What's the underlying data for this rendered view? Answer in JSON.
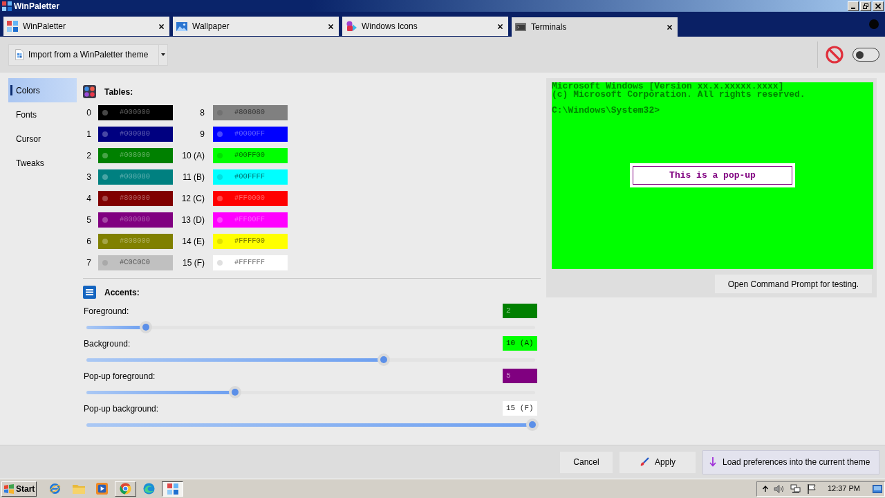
{
  "window": {
    "title": "WinPaletter"
  },
  "tabs": [
    {
      "label": "WinPaletter",
      "selected": false
    },
    {
      "label": "Wallpaper",
      "selected": false
    },
    {
      "label": "Windows Icons",
      "selected": false
    },
    {
      "label": "Terminals",
      "selected": true
    }
  ],
  "toolbar": {
    "import_button": "Import from a WinPaletter theme",
    "toggle": {
      "on": false
    }
  },
  "sidebar": {
    "items": [
      {
        "label": "Colors",
        "selected": true
      },
      {
        "label": "Fonts",
        "selected": false
      },
      {
        "label": "Cursor",
        "selected": false
      },
      {
        "label": "Tweaks",
        "selected": false
      }
    ]
  },
  "tables": {
    "title": "Tables:",
    "swatches": [
      {
        "index": "0",
        "hex": "#000000",
        "color": "#000000"
      },
      {
        "index": "1",
        "hex": "#000080",
        "color": "#000080"
      },
      {
        "index": "2",
        "hex": "#008000",
        "color": "#008000"
      },
      {
        "index": "3",
        "hex": "#008080",
        "color": "#008080"
      },
      {
        "index": "4",
        "hex": "#800000",
        "color": "#800000"
      },
      {
        "index": "5",
        "hex": "#800080",
        "color": "#800080"
      },
      {
        "index": "6",
        "hex": "#808000",
        "color": "#808000"
      },
      {
        "index": "7",
        "hex": "#C0C0C0",
        "color": "#c0c0c0"
      },
      {
        "index": "8",
        "hex": "#808080",
        "color": "#808080"
      },
      {
        "index": "9",
        "hex": "#0000FF",
        "color": "#0000ff"
      },
      {
        "index": "10 (A)",
        "hex": "#00FF00",
        "color": "#00ff00"
      },
      {
        "index": "11 (B)",
        "hex": "#00FFFF",
        "color": "#00ffff"
      },
      {
        "index": "12 (C)",
        "hex": "#FF0000",
        "color": "#ff0000"
      },
      {
        "index": "13 (D)",
        "hex": "#FF00FF",
        "color": "#ff00ff"
      },
      {
        "index": "14 (E)",
        "hex": "#FFFF00",
        "color": "#ffff00"
      },
      {
        "index": "15 (F)",
        "hex": "#FFFFFF",
        "color": "#ffffff"
      }
    ]
  },
  "accents": {
    "title": "Accents:",
    "items": [
      {
        "label": "Foreground:",
        "value": "2",
        "color": "#008000",
        "level": 0.133
      },
      {
        "label": "Background:",
        "value": "10 (A)",
        "color": "#00ff00",
        "level": 0.667
      },
      {
        "label": "Pop-up foreground:",
        "value": "5",
        "color": "#800080",
        "level": 0.333
      },
      {
        "label": "Pop-up background:",
        "value": "15 (F)",
        "color": "#ffffff",
        "level": 1
      }
    ]
  },
  "preview": {
    "lines": [
      "Microsoft Windows [Version xx.x.xxxxx.xxxx]",
      "(c) Microsoft Corporation. All rights reserved."
    ],
    "prompt": "C:\\Windows\\System32>",
    "popup": "This is a pop-up",
    "test_button": "Open Command Prompt for testing."
  },
  "footer": {
    "buttons": [
      {
        "label": "Cancel",
        "kind": "plain"
      },
      {
        "label": "Apply",
        "kind": "apply"
      },
      {
        "label": "Load preferences into the current theme",
        "kind": "load"
      }
    ]
  },
  "taskbar": {
    "start": "Start",
    "apps": [
      {
        "open": false,
        "selected": false
      },
      {
        "open": false,
        "selected": false
      },
      {
        "open": false,
        "selected": false
      },
      {
        "open": true,
        "selected": false
      },
      {
        "open": false,
        "selected": false
      },
      {
        "open": true,
        "selected": true
      }
    ],
    "clock": "12:37 PM"
  }
}
